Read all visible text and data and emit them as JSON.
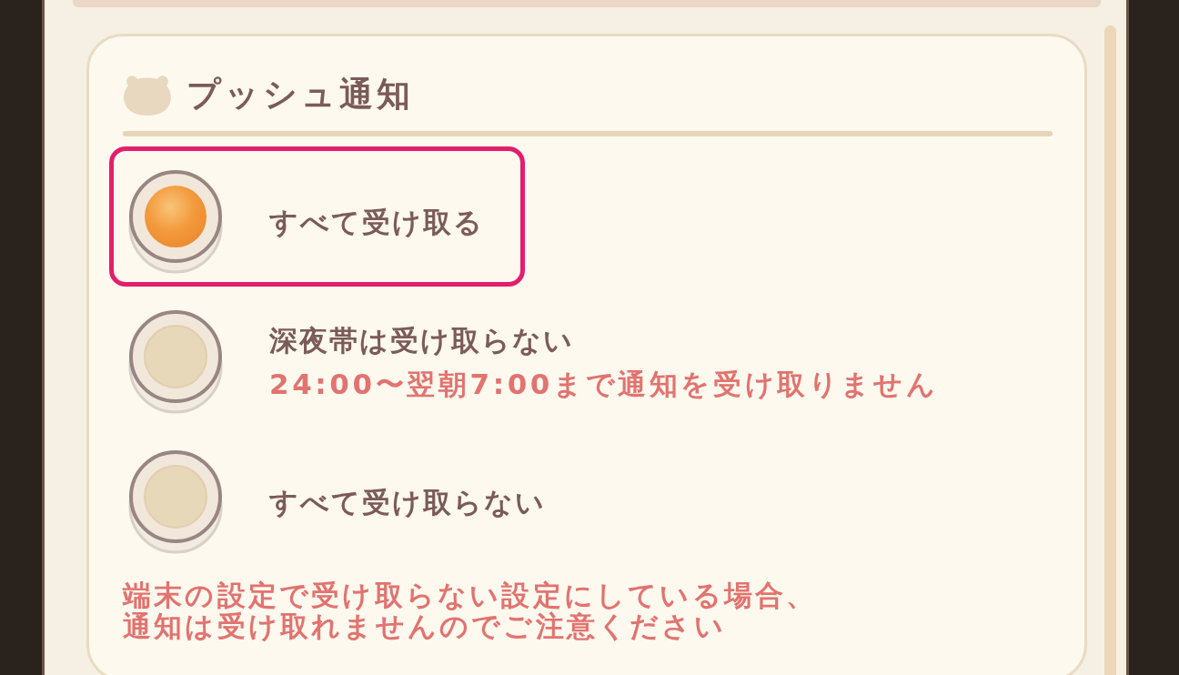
{
  "section": {
    "title": "プッシュ通知"
  },
  "options": [
    {
      "label": "すべて受け取る",
      "selected": true,
      "highlighted": true
    },
    {
      "label": "深夜帯は受け取らない",
      "description": "24:00〜翌朝7:00まで通知を受け取りません",
      "selected": false,
      "highlighted": false
    },
    {
      "label": "すべて受け取らない",
      "selected": false,
      "highlighted": false
    }
  ],
  "note": "端末の設定で受け取らない設定にしている場合、通知は受け取れませんのでご注意ください"
}
